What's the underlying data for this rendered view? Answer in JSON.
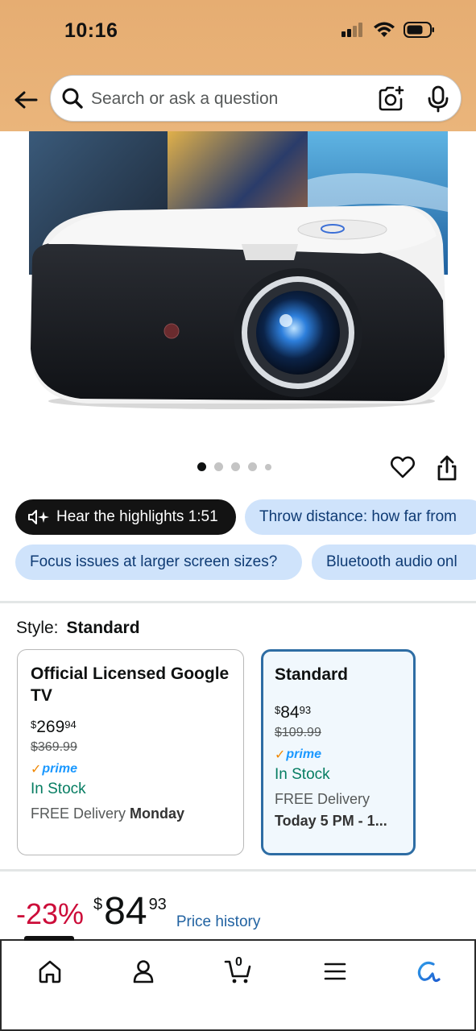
{
  "status": {
    "time": "10:16"
  },
  "search": {
    "placeholder": "Search or ask a question"
  },
  "carousel": {
    "dot_count": 5,
    "active_index": 0
  },
  "highlights": {
    "label": "Hear the highlights 1:51"
  },
  "questions": [
    "Throw distance: how far from",
    "Focus issues at larger screen sizes?",
    "Bluetooth audio onl"
  ],
  "style": {
    "key": "Style:",
    "selected": "Standard",
    "options": [
      {
        "title": "Official Licensed Google TV",
        "price_symbol": "$",
        "price_whole": "269",
        "price_fraction": "94",
        "list_price": "$369.99",
        "prime": "prime",
        "stock": "In Stock",
        "delivery_prefix": "FREE Delivery ",
        "delivery_date": "Monday"
      },
      {
        "title": "Standard",
        "price_symbol": "$",
        "price_whole": "84",
        "price_fraction": "93",
        "list_price": "$109.99",
        "prime": "prime",
        "stock": "In Stock",
        "delivery_prefix": "FREE Delivery",
        "delivery_date": "Today 5 PM - 1..."
      }
    ]
  },
  "price": {
    "discount": "-23%",
    "symbol": "$",
    "whole": "84",
    "fraction": "93",
    "history_label": "Price history"
  },
  "colors": {
    "header_bg": "#e8b177",
    "discount": "#cc0c39",
    "link": "#2162a1",
    "selected_border": "#2e6da4",
    "stock_green": "#067d62",
    "pill_blue": "#cfe3fb"
  },
  "nav": [
    "home-icon",
    "account-icon",
    "cart-icon",
    "menu-icon",
    "rufus-icon"
  ],
  "cart": {
    "count": "0"
  }
}
